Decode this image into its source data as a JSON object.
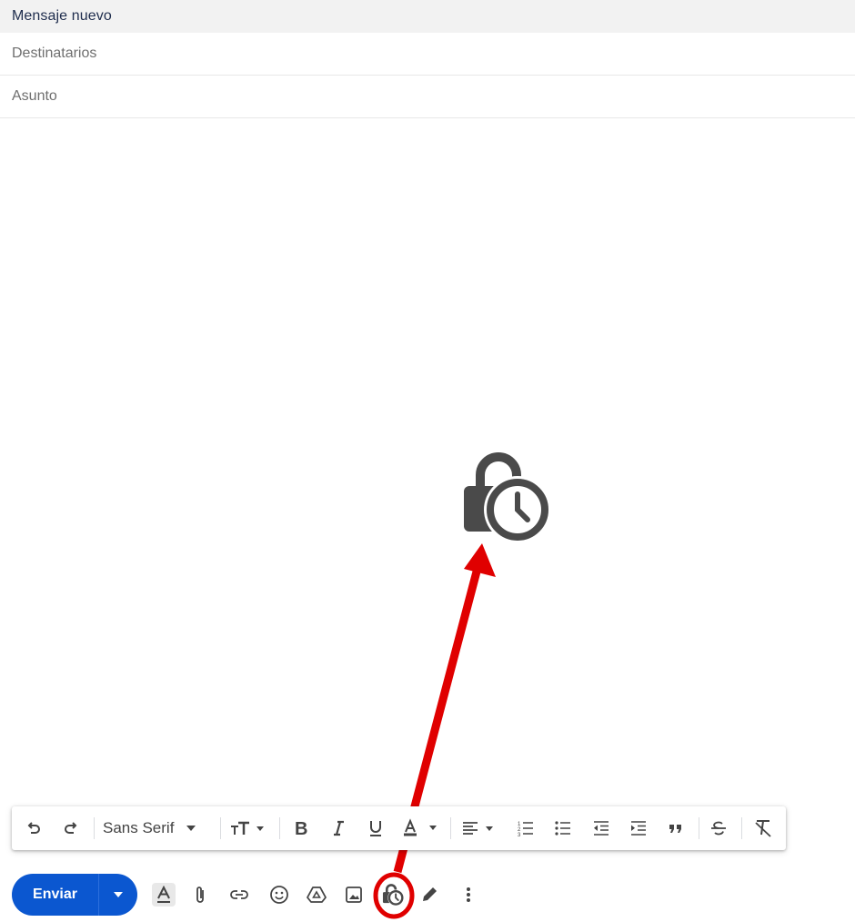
{
  "header": {
    "title": "Mensaje nuevo"
  },
  "recipients": {
    "placeholder": "Destinatarios"
  },
  "subject": {
    "placeholder": "Asunto"
  },
  "format_toolbar": {
    "font_name": "Sans Serif"
  },
  "send": {
    "label": "Enviar"
  },
  "colors": {
    "send_button": "#0b57d0",
    "highlight": "#e00000",
    "header_bg": "#f2f2f2"
  },
  "icons": {
    "callout": "lock-clock-icon",
    "format_toolbar": [
      "undo-icon",
      "redo-icon",
      "font-dropdown-icon",
      "text-size-icon",
      "bold-icon",
      "italic-icon",
      "underline-icon",
      "text-color-icon",
      "align-icon",
      "numbered-list-icon",
      "bulleted-list-icon",
      "indent-less-icon",
      "indent-more-icon",
      "quote-icon",
      "strikethrough-icon",
      "remove-formatting-icon"
    ],
    "bottom_toolbar": [
      "formatting-options-icon",
      "attach-icon",
      "link-icon",
      "emoji-icon",
      "drive-icon",
      "photo-icon",
      "confidential-mode-icon",
      "signature-icon",
      "more-options-icon"
    ]
  }
}
